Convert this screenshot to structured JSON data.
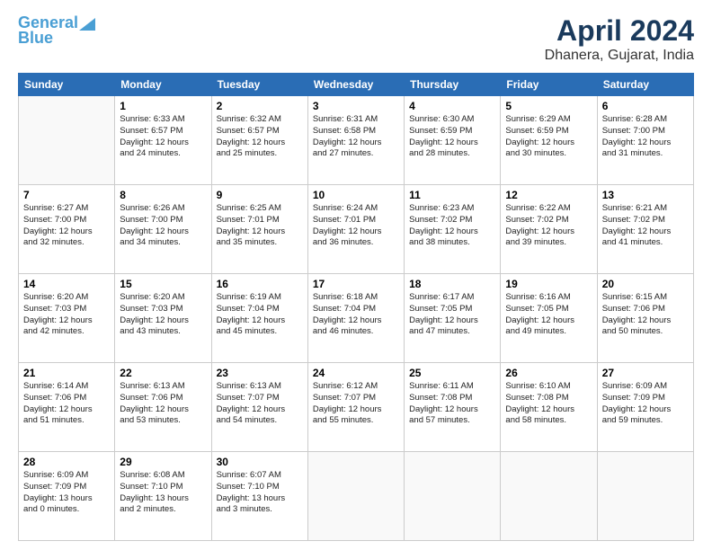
{
  "header": {
    "logo_line1": "General",
    "logo_line2": "Blue",
    "title": "April 2024",
    "subtitle": "Dhanera, Gujarat, India"
  },
  "days_of_week": [
    "Sunday",
    "Monday",
    "Tuesday",
    "Wednesday",
    "Thursday",
    "Friday",
    "Saturday"
  ],
  "weeks": [
    [
      {
        "num": "",
        "info": ""
      },
      {
        "num": "1",
        "info": "Sunrise: 6:33 AM\nSunset: 6:57 PM\nDaylight: 12 hours\nand 24 minutes."
      },
      {
        "num": "2",
        "info": "Sunrise: 6:32 AM\nSunset: 6:57 PM\nDaylight: 12 hours\nand 25 minutes."
      },
      {
        "num": "3",
        "info": "Sunrise: 6:31 AM\nSunset: 6:58 PM\nDaylight: 12 hours\nand 27 minutes."
      },
      {
        "num": "4",
        "info": "Sunrise: 6:30 AM\nSunset: 6:59 PM\nDaylight: 12 hours\nand 28 minutes."
      },
      {
        "num": "5",
        "info": "Sunrise: 6:29 AM\nSunset: 6:59 PM\nDaylight: 12 hours\nand 30 minutes."
      },
      {
        "num": "6",
        "info": "Sunrise: 6:28 AM\nSunset: 7:00 PM\nDaylight: 12 hours\nand 31 minutes."
      }
    ],
    [
      {
        "num": "7",
        "info": "Sunrise: 6:27 AM\nSunset: 7:00 PM\nDaylight: 12 hours\nand 32 minutes."
      },
      {
        "num": "8",
        "info": "Sunrise: 6:26 AM\nSunset: 7:00 PM\nDaylight: 12 hours\nand 34 minutes."
      },
      {
        "num": "9",
        "info": "Sunrise: 6:25 AM\nSunset: 7:01 PM\nDaylight: 12 hours\nand 35 minutes."
      },
      {
        "num": "10",
        "info": "Sunrise: 6:24 AM\nSunset: 7:01 PM\nDaylight: 12 hours\nand 36 minutes."
      },
      {
        "num": "11",
        "info": "Sunrise: 6:23 AM\nSunset: 7:02 PM\nDaylight: 12 hours\nand 38 minutes."
      },
      {
        "num": "12",
        "info": "Sunrise: 6:22 AM\nSunset: 7:02 PM\nDaylight: 12 hours\nand 39 minutes."
      },
      {
        "num": "13",
        "info": "Sunrise: 6:21 AM\nSunset: 7:02 PM\nDaylight: 12 hours\nand 41 minutes."
      }
    ],
    [
      {
        "num": "14",
        "info": "Sunrise: 6:20 AM\nSunset: 7:03 PM\nDaylight: 12 hours\nand 42 minutes."
      },
      {
        "num": "15",
        "info": "Sunrise: 6:20 AM\nSunset: 7:03 PM\nDaylight: 12 hours\nand 43 minutes."
      },
      {
        "num": "16",
        "info": "Sunrise: 6:19 AM\nSunset: 7:04 PM\nDaylight: 12 hours\nand 45 minutes."
      },
      {
        "num": "17",
        "info": "Sunrise: 6:18 AM\nSunset: 7:04 PM\nDaylight: 12 hours\nand 46 minutes."
      },
      {
        "num": "18",
        "info": "Sunrise: 6:17 AM\nSunset: 7:05 PM\nDaylight: 12 hours\nand 47 minutes."
      },
      {
        "num": "19",
        "info": "Sunrise: 6:16 AM\nSunset: 7:05 PM\nDaylight: 12 hours\nand 49 minutes."
      },
      {
        "num": "20",
        "info": "Sunrise: 6:15 AM\nSunset: 7:06 PM\nDaylight: 12 hours\nand 50 minutes."
      }
    ],
    [
      {
        "num": "21",
        "info": "Sunrise: 6:14 AM\nSunset: 7:06 PM\nDaylight: 12 hours\nand 51 minutes."
      },
      {
        "num": "22",
        "info": "Sunrise: 6:13 AM\nSunset: 7:06 PM\nDaylight: 12 hours\nand 53 minutes."
      },
      {
        "num": "23",
        "info": "Sunrise: 6:13 AM\nSunset: 7:07 PM\nDaylight: 12 hours\nand 54 minutes."
      },
      {
        "num": "24",
        "info": "Sunrise: 6:12 AM\nSunset: 7:07 PM\nDaylight: 12 hours\nand 55 minutes."
      },
      {
        "num": "25",
        "info": "Sunrise: 6:11 AM\nSunset: 7:08 PM\nDaylight: 12 hours\nand 57 minutes."
      },
      {
        "num": "26",
        "info": "Sunrise: 6:10 AM\nSunset: 7:08 PM\nDaylight: 12 hours\nand 58 minutes."
      },
      {
        "num": "27",
        "info": "Sunrise: 6:09 AM\nSunset: 7:09 PM\nDaylight: 12 hours\nand 59 minutes."
      }
    ],
    [
      {
        "num": "28",
        "info": "Sunrise: 6:09 AM\nSunset: 7:09 PM\nDaylight: 13 hours\nand 0 minutes."
      },
      {
        "num": "29",
        "info": "Sunrise: 6:08 AM\nSunset: 7:10 PM\nDaylight: 13 hours\nand 2 minutes."
      },
      {
        "num": "30",
        "info": "Sunrise: 6:07 AM\nSunset: 7:10 PM\nDaylight: 13 hours\nand 3 minutes."
      },
      {
        "num": "",
        "info": ""
      },
      {
        "num": "",
        "info": ""
      },
      {
        "num": "",
        "info": ""
      },
      {
        "num": "",
        "info": ""
      }
    ]
  ]
}
